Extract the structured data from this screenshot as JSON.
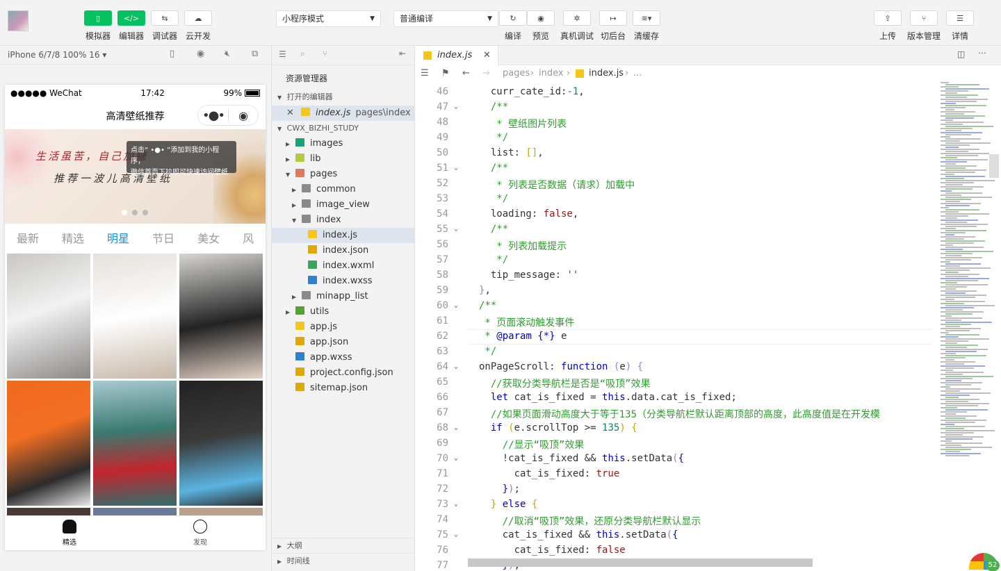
{
  "toolbar": {
    "left": [
      {
        "label": "模拟器",
        "icon": "phone-icon"
      },
      {
        "label": "编辑器",
        "icon": "code-icon"
      },
      {
        "label": "调试器",
        "icon": "debug-arrows-icon"
      },
      {
        "label": "云开发",
        "icon": "cloud-icon"
      }
    ],
    "mode_select": "小程序模式",
    "compile_select": "普通编译",
    "right": [
      {
        "label": "编译",
        "icon": "refresh-icon"
      },
      {
        "label": "预览",
        "icon": "eye-icon"
      },
      {
        "label": "真机调试",
        "icon": "bug-icon"
      },
      {
        "label": "切后台",
        "icon": "switch-icon"
      },
      {
        "label": "清缓存",
        "icon": "layers-icon"
      }
    ],
    "far_right": [
      {
        "label": "上传",
        "icon": "upload-icon"
      },
      {
        "label": "版本管理",
        "icon": "branch-icon"
      },
      {
        "label": "详情",
        "icon": "menu-icon"
      }
    ]
  },
  "simulator": {
    "device": "iPhone 6/7/8 100% 16 ▾",
    "status": {
      "carrier": "●●●●● WeChat",
      "time": "17:42",
      "battery": "99%"
    },
    "nav_title": "高清壁纸推荐",
    "banner": {
      "line1": "生活虽苦，自己加糖",
      "line2": "推荐一波儿高清壁纸",
      "tip_line1": "点击“ •●• ”添加到我的小程序，",
      "tip_line2": "微信首页下拉即可快速访问壁纸"
    },
    "tabs": [
      "最新",
      "精选",
      "明星",
      "节日",
      "美女",
      "风"
    ],
    "active_tab": 2,
    "bottom_nav": [
      {
        "label": "精选",
        "icon": "home-icon"
      },
      {
        "label": "发现",
        "icon": "discover-icon"
      }
    ]
  },
  "explorer": {
    "title": "资源管理器",
    "open_editors": "打开的编辑器",
    "open_file": "index.js",
    "open_path": "pages\\index",
    "project": "CWX_BIZHI_STUDY",
    "tree": [
      {
        "name": "images",
        "depth": 1,
        "type": "folder",
        "color": "#1aa07a"
      },
      {
        "name": "lib",
        "depth": 1,
        "type": "folder",
        "color": "#b5c93a"
      },
      {
        "name": "pages",
        "depth": 1,
        "type": "folder-open",
        "color": "#e07a5f"
      },
      {
        "name": "common",
        "depth": 2,
        "type": "folder",
        "color": "#8a8a8a"
      },
      {
        "name": "image_view",
        "depth": 2,
        "type": "folder",
        "color": "#8a8a8a"
      },
      {
        "name": "index",
        "depth": 2,
        "type": "folder-open",
        "color": "#8a8a8a"
      },
      {
        "name": "index.js",
        "depth": 3,
        "type": "js",
        "color": "#f5c518"
      },
      {
        "name": "index.json",
        "depth": 3,
        "type": "json",
        "color": "#e0a800"
      },
      {
        "name": "index.wxml",
        "depth": 3,
        "type": "wxml",
        "color": "#3aa55d"
      },
      {
        "name": "index.wxss",
        "depth": 3,
        "type": "wxss",
        "color": "#2f7fd3"
      },
      {
        "name": "minapp_list",
        "depth": 2,
        "type": "folder",
        "color": "#8a8a8a"
      },
      {
        "name": "utils",
        "depth": 1,
        "type": "folder",
        "color": "#5aa02c"
      },
      {
        "name": "app.js",
        "depth": 1,
        "type": "js",
        "color": "#f5c518"
      },
      {
        "name": "app.json",
        "depth": 1,
        "type": "json",
        "color": "#e0a800"
      },
      {
        "name": "app.wxss",
        "depth": 1,
        "type": "wxss",
        "color": "#2f7fd3"
      },
      {
        "name": "project.config.json",
        "depth": 1,
        "type": "json",
        "color": "#e0a800"
      },
      {
        "name": "sitemap.json",
        "depth": 1,
        "type": "json",
        "color": "#e0a800"
      }
    ],
    "outline": "大纲",
    "timeline": "时间线"
  },
  "editor": {
    "tab": "index.js",
    "breadcrumb": [
      "pages",
      "index",
      "index.js",
      "..."
    ],
    "lines": [
      {
        "n": 46,
        "html": "  curr_cate_id:<span class=\"num\">-1</span>,"
      },
      {
        "n": 47,
        "fold": true,
        "html": "  <span class=\"cm\">/**</span>"
      },
      {
        "n": 48,
        "html": "  <span class=\"cm\"> * 壁纸图片列表</span>"
      },
      {
        "n": 49,
        "html": "  <span class=\"cm\"> */</span>"
      },
      {
        "n": 50,
        "html": "  list: <span class=\"br\">[]</span>,"
      },
      {
        "n": 51,
        "fold": true,
        "html": "  <span class=\"cm\">/**</span>"
      },
      {
        "n": 52,
        "html": "  <span class=\"cm\"> * 列表是否数据（请求）加载中</span>"
      },
      {
        "n": 53,
        "html": "  <span class=\"cm\"> */</span>"
      },
      {
        "n": 54,
        "html": "  loading: <span class=\"str\">false</span>,"
      },
      {
        "n": 55,
        "fold": true,
        "html": "  <span class=\"cm\">/**</span>"
      },
      {
        "n": 56,
        "html": "  <span class=\"cm\"> * 列表加载提示</span>"
      },
      {
        "n": 57,
        "html": "  <span class=\"cm\"> */</span>"
      },
      {
        "n": 58,
        "html": "  tip_message: <span class=\"str\">''</span>"
      },
      {
        "n": 59,
        "html": "<span class=\"pu\">}</span>,"
      },
      {
        "n": 60,
        "fold": true,
        "html": "<span class=\"cm\">/**</span>"
      },
      {
        "n": 61,
        "html": "<span class=\"cm\"> * 页面滚动触发事件</span>"
      },
      {
        "n": 62,
        "html": "<span class=\"cm\"> * </span><span class=\"th\">@param</span> <span class=\"kw\">{*}</span> e"
      },
      {
        "n": 63,
        "html": "<span class=\"cm\"> */</span>"
      },
      {
        "n": 64,
        "fold": true,
        "html": "onPageScroll: <span class=\"kw\">function</span> <span class=\"pu\">(</span>e<span class=\"pu\">)</span> <span class=\"pu\">{</span>"
      },
      {
        "n": 65,
        "html": "  <span class=\"cm\">//获取分类导航栏是否是“吸顶”效果</span>"
      },
      {
        "n": 66,
        "html": "  <span class=\"kw\">let</span> cat_is_fixed = <span class=\"th\">this</span>.data.cat_is_fixed;"
      },
      {
        "n": 67,
        "html": "  <span class=\"cm\">//如果页面滑动高度大于等于135（分类导航栏默认距离顶部的高度，此高度值是在开发模</span>"
      },
      {
        "n": 68,
        "fold": true,
        "html": "  <span class=\"kw\">if</span> <span class=\"br\">(</span>e.scrollTop &gt;= <span class=\"num\">135</span><span class=\"br\">)</span> <span class=\"br\">{</span>"
      },
      {
        "n": 69,
        "html": "    <span class=\"cm\">//显示“吸顶”效果</span>"
      },
      {
        "n": 70,
        "fold": true,
        "html": "    !cat_is_fixed &amp;&amp; <span class=\"th\">this</span>.setData<span class=\"pu\">(</span><span class=\"kw\">{</span>"
      },
      {
        "n": 71,
        "html": "      cat_is_fixed: <span class=\"str\">true</span>"
      },
      {
        "n": 72,
        "html": "    <span class=\"kw\">}</span><span class=\"pu\">)</span>;"
      },
      {
        "n": 73,
        "fold": true,
        "html": "  <span class=\"br\">}</span> <span class=\"kw\">else</span> <span class=\"br\">{</span>"
      },
      {
        "n": 74,
        "html": "    <span class=\"cm\">//取消“吸顶”效果，还原分类导航栏默认显示</span>"
      },
      {
        "n": 75,
        "fold": true,
        "html": "    cat_is_fixed &amp;&amp; <span class=\"th\">this</span>.setData<span class=\"pu\">(</span><span class=\"kw\">{</span>"
      },
      {
        "n": 76,
        "html": "      cat_is_fixed: <span class=\"str\">false</span>"
      },
      {
        "n": 77,
        "html": "    <span class=\"kw\">}</span><span class=\"pu\">)</span>;"
      }
    ]
  },
  "badge": "52"
}
